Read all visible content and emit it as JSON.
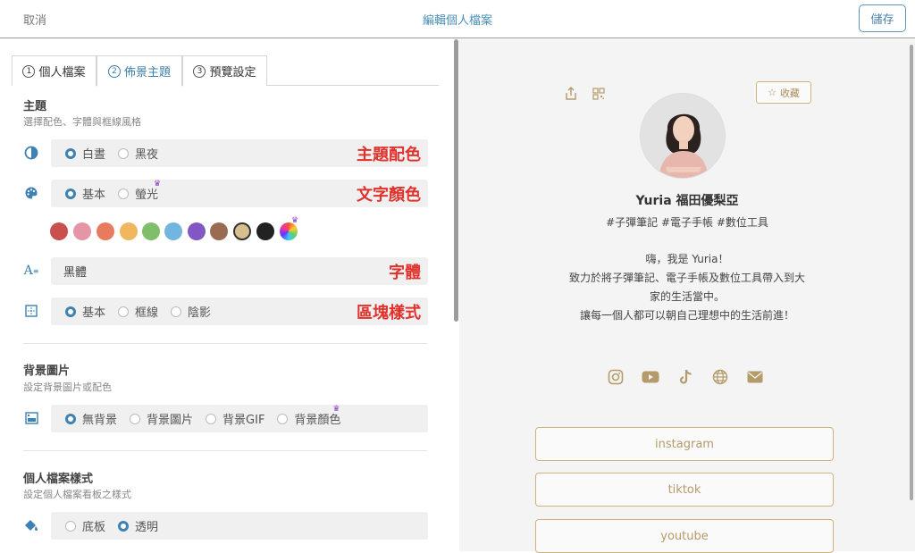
{
  "header": {
    "cancel": "取消",
    "title": "編輯個人檔案",
    "save": "儲存"
  },
  "tabs": [
    {
      "num": "1",
      "label": "個人檔案"
    },
    {
      "num": "2",
      "label": "佈景主題"
    },
    {
      "num": "3",
      "label": "預覽設定"
    }
  ],
  "theme": {
    "heading": "主題",
    "subtitle": "選擇配色、字體與框線風格",
    "scheme": {
      "options": [
        "白晝",
        "黑夜"
      ],
      "annotation": "主題配色"
    },
    "text_color": {
      "options": [
        "基本",
        "螢光"
      ],
      "annotation": "文字顏色"
    },
    "swatches": [
      "#c9504e",
      "#e595a6",
      "#e87a5e",
      "#f0b75e",
      "#7fbf6a",
      "#72b5de",
      "#8256c3",
      "#9a6a52",
      "#d8c08e",
      "#222222",
      "rainbow"
    ],
    "font": {
      "value": "黑體",
      "annotation": "字體"
    },
    "block": {
      "options": [
        "基本",
        "框線",
        "陰影"
      ],
      "annotation": "區塊樣式"
    }
  },
  "background": {
    "heading": "背景圖片",
    "subtitle": "設定背景圖片或配色",
    "options": [
      "無背景",
      "背景圖片",
      "背景GIF",
      "背景顏色"
    ]
  },
  "profile_style": {
    "heading": "個人檔案樣式",
    "subtitle": "設定個人檔案看板之樣式",
    "options": [
      "底板",
      "透明"
    ]
  },
  "preview": {
    "favorite": "收藏",
    "name": "Yuria 福田優梨亞",
    "tags": "#子彈筆記 #電子手帳 #數位工具",
    "bio": [
      "嗨，我是 Yuria！",
      "致力於將子彈筆記、電子手帳及數位工具帶入到大家的生活當中。",
      "讓每一個人都可以朝自己理想中的生活前進！"
    ],
    "links": [
      "instagram",
      "tiktok",
      "youtube"
    ]
  },
  "colors": {
    "accent": "#3d82b3",
    "annotation_red": "#e0322c",
    "gold": "#d1b27d"
  }
}
